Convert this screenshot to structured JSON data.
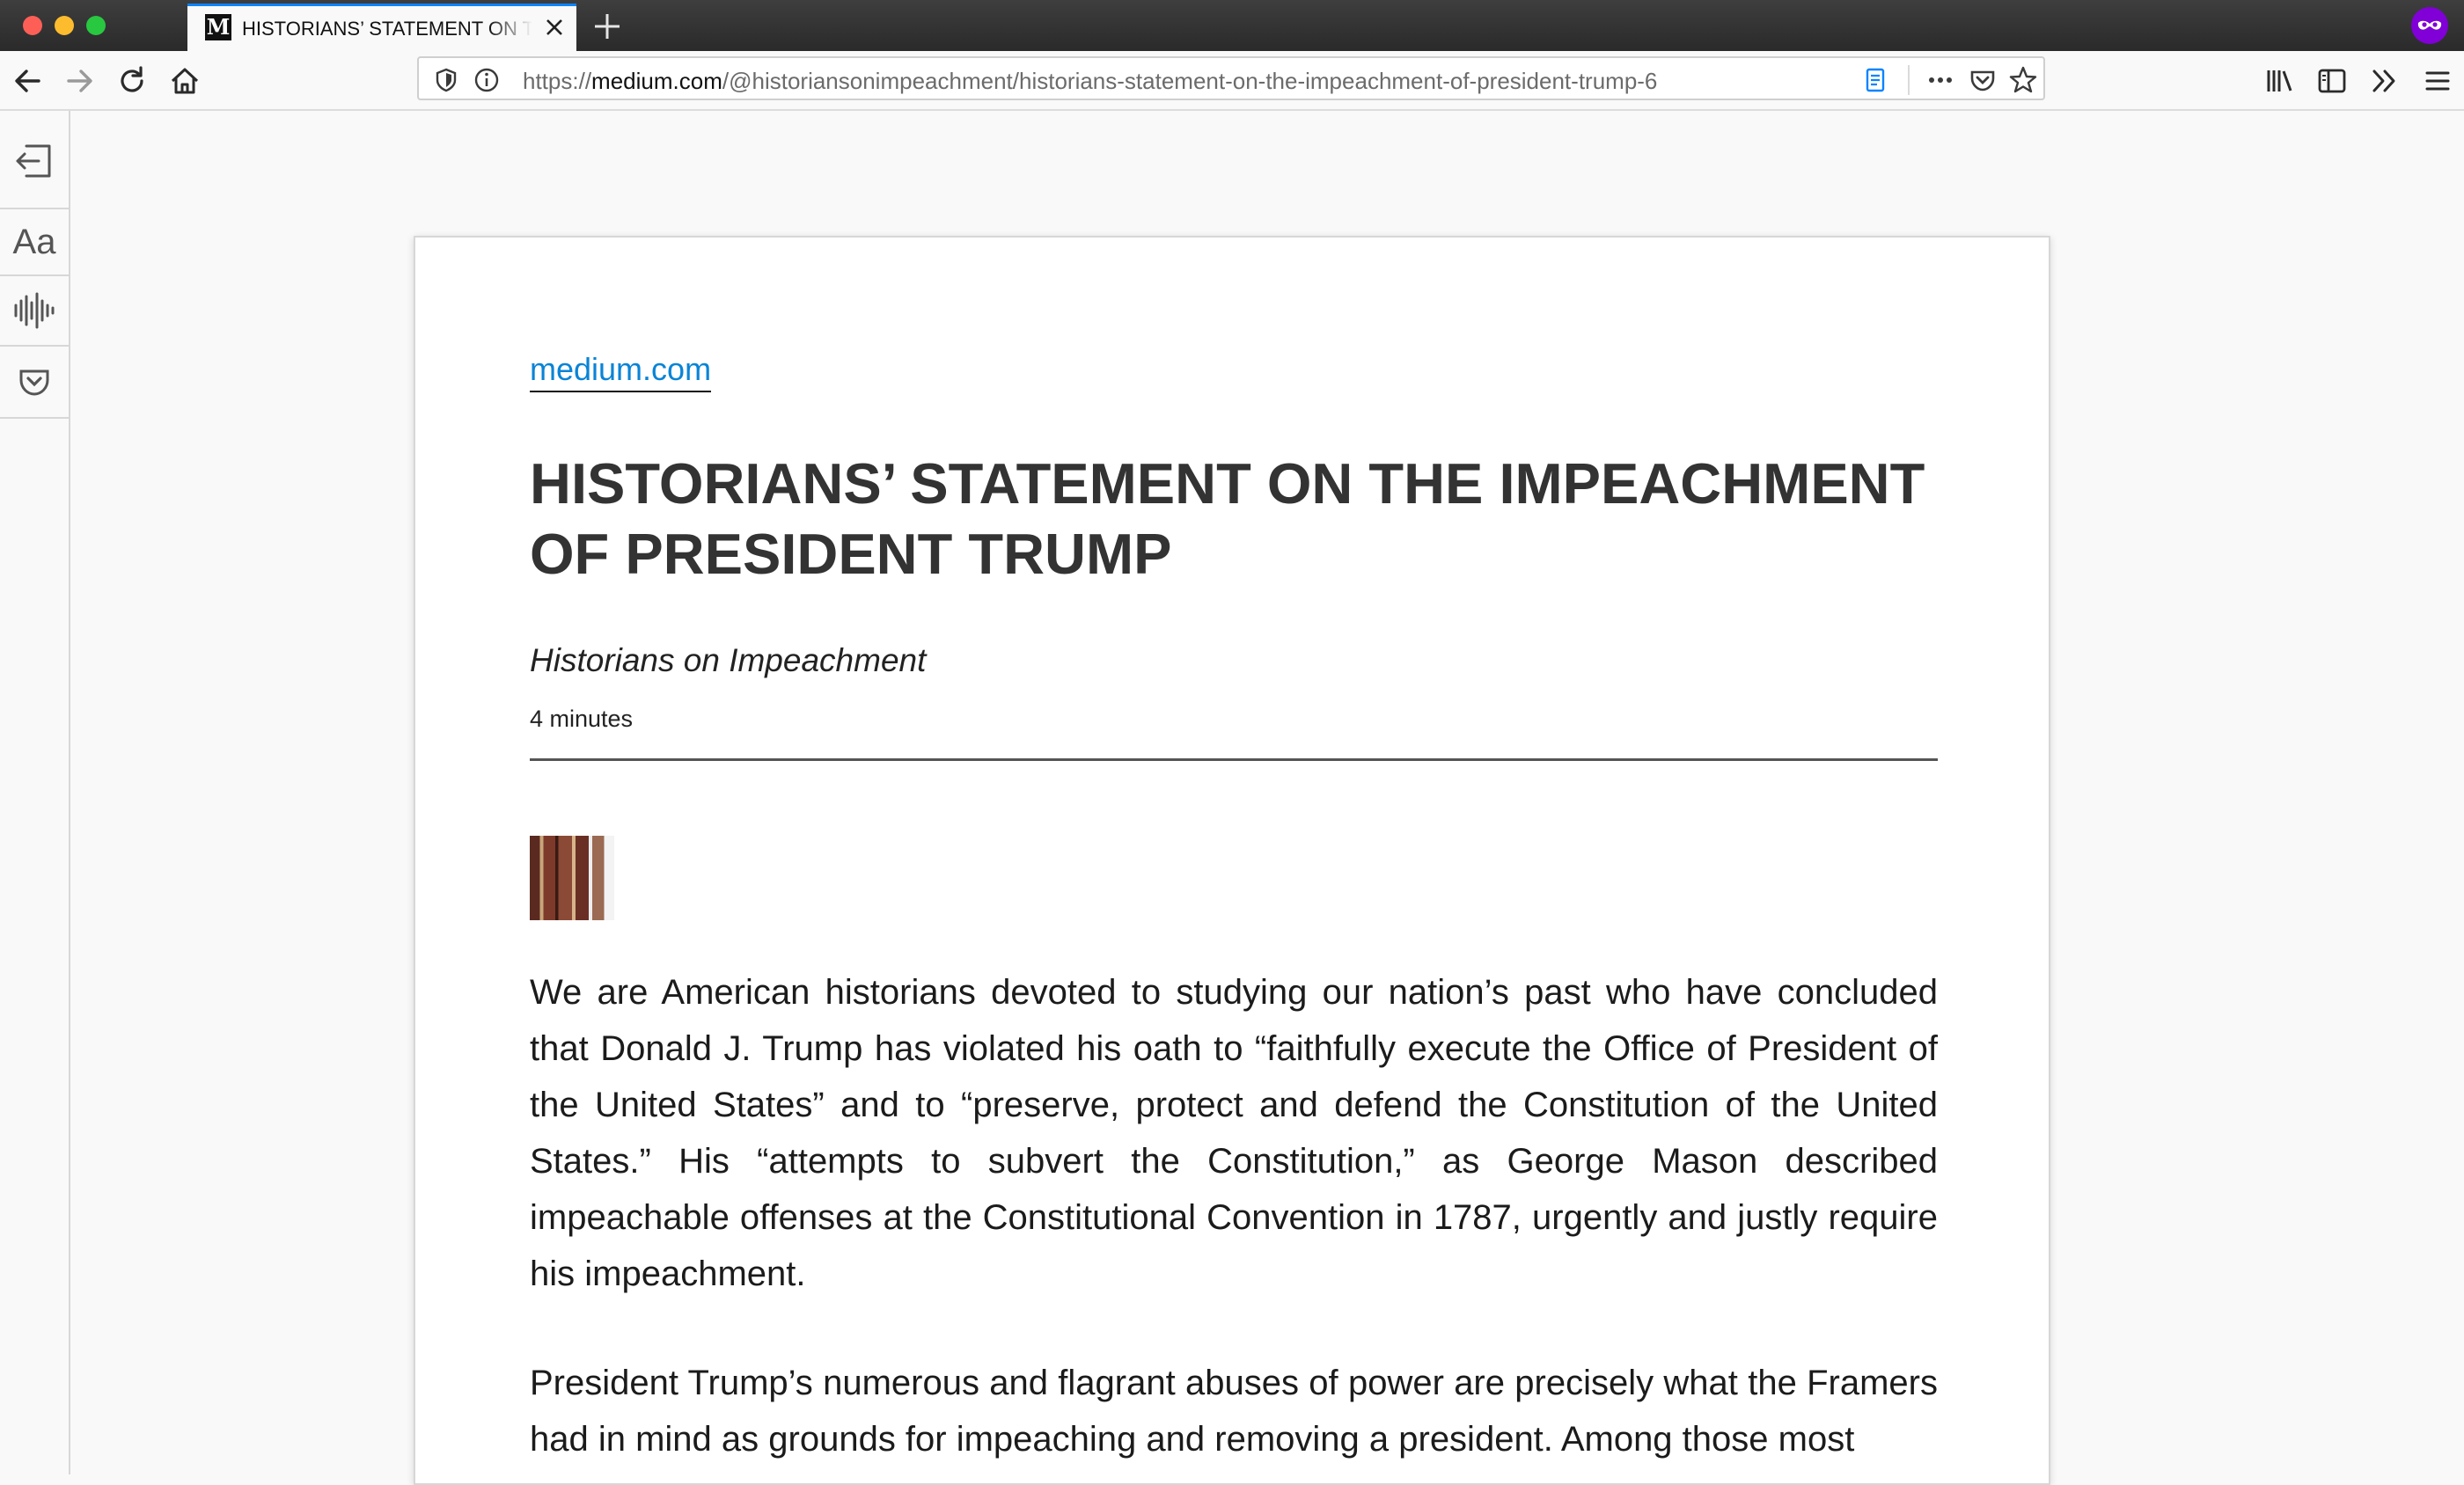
{
  "browser": {
    "tab": {
      "favicon_letter": "M",
      "title": "HISTORIANS’ STATEMENT ON THE IMPEACHMENT OF PRESIDENT TRUMP"
    },
    "url": {
      "prefix": "https://",
      "host": "medium.com",
      "path": "/@historiansonimpeachment/historians-statement-on-the-impeachment-of-president-trump-6"
    },
    "icons": {
      "back": "back-arrow-icon",
      "forward": "forward-arrow-icon",
      "reload": "reload-icon",
      "home": "home-icon",
      "tracking": "tracking-protection-shield-icon",
      "info": "site-info-icon",
      "reader": "reader-view-icon",
      "more": "more-actions-icon",
      "pocket": "pocket-icon",
      "bookmark": "bookmark-star-icon",
      "library": "library-icon",
      "sidebar": "sidebar-icon",
      "overflow": "overflow-chevron-icon",
      "menu": "hamburger-menu-icon",
      "private": "private-browsing-icon"
    },
    "accent_color": "#0a84ff",
    "private_color": "#8000d7"
  },
  "reader_toolbar": {
    "text_settings_label": "Aa"
  },
  "article": {
    "domain": "medium.com",
    "title": "HISTORIANS’ STATEMENT ON THE IMPEACHMENT OF PRESIDENT TRUMP",
    "byline": "Historians on Impeachment",
    "reading_time": "4 minutes",
    "paragraphs": [
      "We are American historians devoted to studying our nation’s past who have concluded that Donald J. Trump has violated his oath to “faithfully execute the Office of President of the United States” and to “preserve, protect and defend the Constitution of the United States.” His “attempts to subvert the Constitution,” as George Mason described impeachable offenses at the Constitutional Convention in 1787, urgently and justly require his impeachment.",
      "President Trump’s numerous and flagrant abuses of power are precisely what the Framers had in mind as grounds for impeaching and removing a president. Among those most"
    ]
  }
}
